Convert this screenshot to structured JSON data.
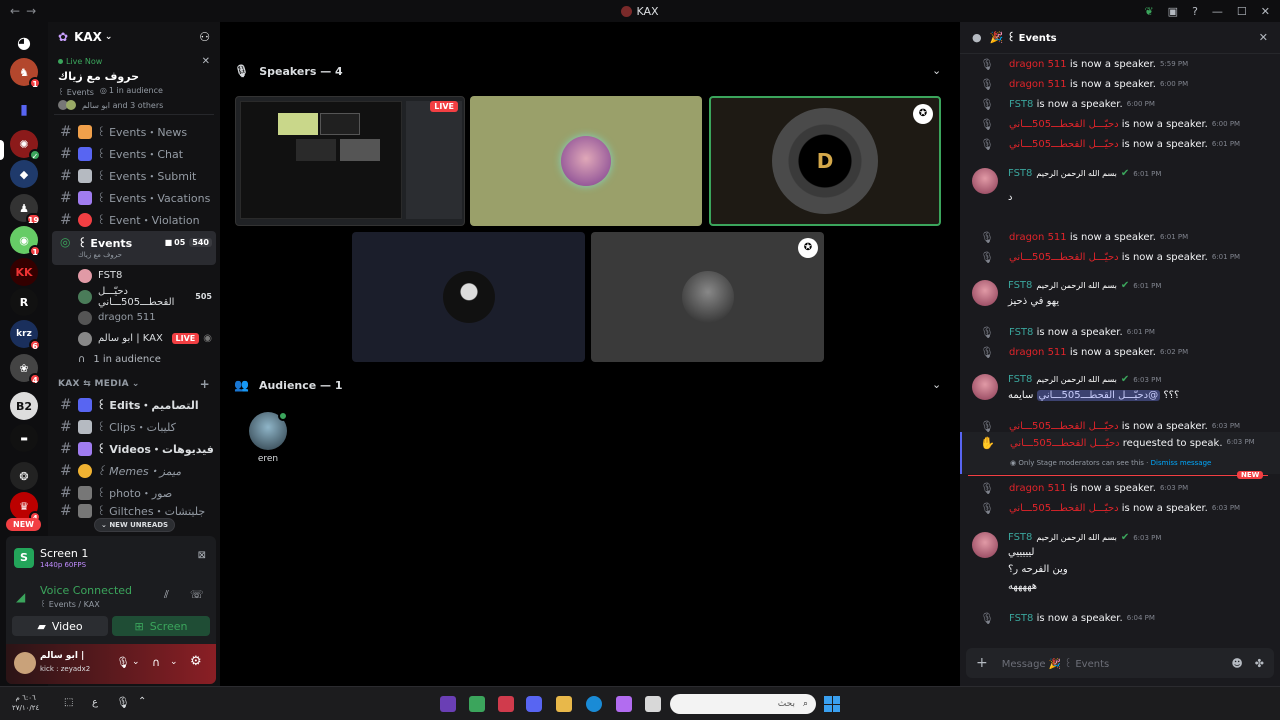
{
  "window": {
    "title": "KAX",
    "back": "←",
    "forward": "→"
  },
  "server": {
    "name": "KAX"
  },
  "live_card": {
    "status": "Live Now",
    "event_name": "حروف مع زياك",
    "channel": "꒰ Events",
    "audience": "1 in audience",
    "others": "ابو سالم and 3 others"
  },
  "channels": [
    {
      "emoji_color": "#f0a04b",
      "label": "꒰ Events・News"
    },
    {
      "emoji_color": "#5865f2",
      "label": "꒰ Events・Chat"
    },
    {
      "emoji_color": "#b5bac1",
      "label": "꒰ Events・Submit"
    },
    {
      "emoji_color": "#a07cf0",
      "label": "꒰ Events・Vacations"
    },
    {
      "emoji_color": "#f23f43",
      "label": "꒰ Event・Violation"
    }
  ],
  "stage_channel": {
    "label": "꒰ Events",
    "subtitle": "حروف مع زياك",
    "count_a": "05",
    "count_b": "540"
  },
  "stage_members": [
    {
      "name": "FST8",
      "tag": "",
      "color": "#e19aa6"
    },
    {
      "name": "دحيّـــل القحطـــ505ـــاني",
      "tag": "505",
      "color": "#4a7c59"
    },
    {
      "name": "dragon 511",
      "tag": "",
      "color": "#555"
    },
    {
      "name": "ابو سالم | KAX",
      "tag": "LIVE",
      "color": "#888"
    }
  ],
  "stage_audience": "1 in audience",
  "media_category": "KAX ⇆ MEDIA",
  "media_channels": [
    {
      "label": "꒰ Edits・التصاميم",
      "emoji_color": "#5865f2"
    },
    {
      "label": "꒰ Clips・كليبات",
      "emoji_color": "#b5bac1"
    },
    {
      "label": "꒰ Videos・فيديوهات",
      "emoji_color": "#a07cf0"
    },
    {
      "label": "꒰ Memes・ميمز",
      "emoji_color": "#f0b232"
    },
    {
      "label": "꒰ photo・صور",
      "emoji_color": "#777"
    },
    {
      "label": "꒰ Giltches・جليتشات",
      "emoji_color": "#777"
    }
  ],
  "new_unreads": "NEW UNREADS",
  "rail_new": "NEW",
  "panel": {
    "screen_title": "Screen 1",
    "screen_quality": "1440p 60FPS",
    "voice_status": "Voice Connected",
    "voice_channel": "꒰ Events / KAX",
    "video_label": "Video",
    "screen_label": "Screen",
    "user_name": "ابو سالم |",
    "user_status": "kick : zeyadx2"
  },
  "stage": {
    "speakers_title": "Speakers — 4",
    "audience_title": "Audience — 1",
    "live_label": "LIVE",
    "audience_member": "eren"
  },
  "chat": {
    "title": "꒰ Events",
    "input_placeholder": "Message 🎉 ꒰ Events",
    "new_label": "NEW",
    "moderator_note": "Only Stage moderators can see this ·",
    "dismiss": "Dismiss message",
    "rows": [
      {
        "name": "dragon 511",
        "text": "is now a speaker.",
        "time": "5:59 PM"
      },
      {
        "name": "dragon 511",
        "text": "is now a speaker.",
        "time": "6:00 PM"
      },
      {
        "name": "FST8",
        "text": "is now a speaker.",
        "time": "6:00 PM"
      },
      {
        "name": "دحيّـــل القحطـــ505ـــاني",
        "text": "is now a speaker.",
        "time": "6:00 PM"
      },
      {
        "name": "دحيّـــل القحطـــ505ـــاني",
        "text": "is now a speaker.",
        "time": "6:01 PM"
      },
      {
        "name": "FST8",
        "text": "د",
        "time": "6:01 PM"
      },
      {
        "name": "dragon 511",
        "text": "is now a speaker.",
        "time": "6:01 PM"
      },
      {
        "name": "دحيّـــل القحطـــ505ـــاني",
        "text": "is now a speaker.",
        "time": "6:01 PM"
      },
      {
        "name": "FST8",
        "text": "يهو في ذحيز",
        "time": "6:01 PM"
      },
      {
        "name": "FST8",
        "text": "is now a speaker.",
        "time": "6:01 PM"
      },
      {
        "name": "dragon 511",
        "text": "is now a speaker.",
        "time": "6:02 PM"
      },
      {
        "name": "FST8",
        "text": "سايمه",
        "mention": "@دحيّـــل القحطـــ505ـــاني",
        "extra": "؟؟؟",
        "time": "6:03 PM"
      },
      {
        "name": "دحيّـــل القحطـــ505ـــاني",
        "text": "is now a speaker.",
        "time": "6:03 PM"
      },
      {
        "name": "دحيّـــل القحطـــ505ـــاني",
        "text": "requested to speak.",
        "time": "6:03 PM"
      },
      {
        "name": "dragon 511",
        "text": "is now a speaker.",
        "time": "6:03 PM"
      },
      {
        "name": "دحيّـــل القحطـــ505ـــاني",
        "text": "is now a speaker.",
        "time": "6:03 PM"
      },
      {
        "name": "FST8",
        "line1": "ليييييي",
        "line2": "وين الفرحه ر؟",
        "line3": "هههههه",
        "time": "6:03 PM"
      },
      {
        "name": "FST8",
        "text": "is now a speaker.",
        "time": "6:04 PM"
      }
    ],
    "user_tag": "بسم الله الرحمن الرحيم"
  },
  "taskbar": {
    "search_placeholder": "بحث",
    "clock_time": "٦:٠٦ م",
    "clock_date": "٢٧/١٠/٢٤",
    "lang": "ع"
  }
}
